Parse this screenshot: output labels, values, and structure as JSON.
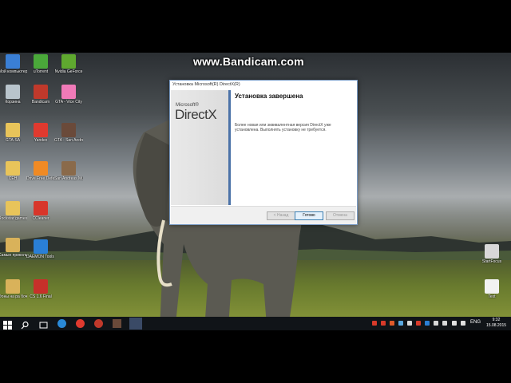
{
  "watermark": "www.Bandicam.com",
  "desktop_icons_left": [
    {
      "label": "Мой компьютер",
      "color": "#3a7fd5"
    },
    {
      "label": "Корзина",
      "color": "#b8c4cc"
    },
    {
      "label": "GTA-SA",
      "color": "#e8c45a"
    },
    {
      "label": "СЕН",
      "color": "#e8c45a"
    },
    {
      "label": "Rockstar games",
      "color": "#e8c45a"
    },
    {
      "label": "Самые прикольные",
      "color": "#d9b25a"
    },
    {
      "label": "Фоны на ра бочий стол",
      "color": "#d9b25a"
    }
  ],
  "desktop_icons_col2": [
    {
      "label": "uTorrent",
      "color": "#4aa83a"
    },
    {
      "label": "Bandicam",
      "color": "#c0392b"
    },
    {
      "label": "Yandex",
      "color": "#e03a2f"
    },
    {
      "label": "Drive Free Defender",
      "color": "#f08a24"
    },
    {
      "label": "CCleaner",
      "color": "#d8362a"
    },
    {
      "label": "DAEMON Tools Lite",
      "color": "#2a7fd6"
    },
    {
      "label": "CS 1.6 Final",
      "color": "#c7302a"
    }
  ],
  "desktop_icons_col3": [
    {
      "label": "Nvidia GeForce",
      "color": "#5fa82f"
    },
    {
      "label": "GTA - Vice City",
      "color": "#f07ab8"
    },
    {
      "label": "GTA - San Andreas",
      "color": "#6a4a3a"
    },
    {
      "label": "San Andreas Multiplayer",
      "color": "#8a6a4a"
    }
  ],
  "desktop_icons_right": [
    {
      "label": "StartFocus",
      "color": "#d8d8d8"
    },
    {
      "label": "Text",
      "color": "#f2f2f2"
    }
  ],
  "dialog": {
    "title": "Установка Microsoft(R) DirectX(R)",
    "logo_ms": "Microsoft®",
    "logo_dx": "DirectX",
    "heading": "Установка завершена",
    "body": "Более новая или эквивалентная версия DirectX уже установлена. Выполнять установку не требуется.",
    "btn_back": "< Назад",
    "btn_finish": "Готово",
    "btn_cancel": "Отмена"
  },
  "taskbar": {
    "lang": "ENG",
    "time": "9:32",
    "date": "15.08.2015"
  },
  "colors": {
    "accent": "#4b72a8",
    "taskbar": "#101418"
  }
}
